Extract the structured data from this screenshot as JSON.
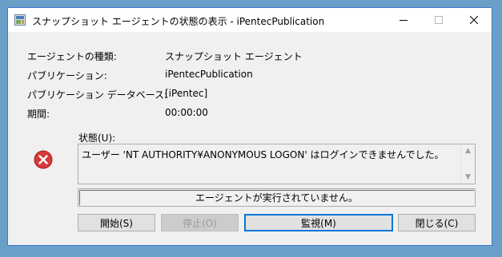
{
  "window": {
    "title": "スナップショット エージェントの状態の表示 - iPentecPublication"
  },
  "info": [
    {
      "label": "エージェントの種類:",
      "value": "スナップショット エージェント"
    },
    {
      "label": "パブリケーション:",
      "value": "iPentecPublication"
    },
    {
      "label": "パブリケーション データベース:",
      "value": "[iPentec]"
    },
    {
      "label": "期間:",
      "value": "00:00:00"
    }
  ],
  "status": {
    "label": "状態(U):",
    "message": "ユーザー 'NT AUTHORITY¥ANONYMOUS LOGON' はログインできませんでした。",
    "icon": "error-icon"
  },
  "agent_status": "エージェントが実行されていません。",
  "buttons": {
    "start": "開始(S)",
    "stop": "停止(O)",
    "monitor": "監視(M)",
    "close": "閉じる(C)"
  }
}
